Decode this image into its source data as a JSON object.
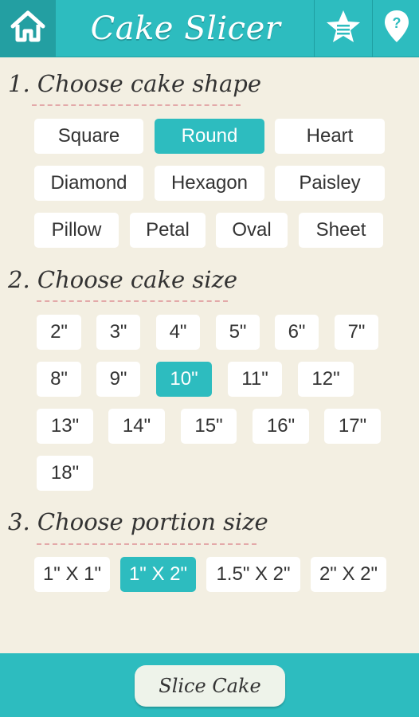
{
  "header": {
    "title": "Cake Slicer",
    "icons": [
      "home-icon",
      "star-list-icon",
      "help-location-icon"
    ]
  },
  "sections": {
    "shape": {
      "title": "1. Choose cake shape"
    },
    "size": {
      "title": "2. Choose cake size"
    },
    "portion": {
      "title": "3. Choose portion size"
    }
  },
  "shapes": [
    "Square",
    "Round",
    "Heart",
    "Diamond",
    "Hexagon",
    "Paisley",
    "Pillow",
    "Petal",
    "Oval",
    "Sheet"
  ],
  "selected_shape": "Round",
  "sizes": [
    "2\"",
    "3\"",
    "4\"",
    "5\"",
    "6\"",
    "7\"",
    "8\"",
    "9\"",
    "10\"",
    "11\"",
    "12\"",
    "13\"",
    "14\"",
    "15\"",
    "16\"",
    "17\"",
    "18\""
  ],
  "selected_size": "10\"",
  "portions": [
    "1\" X 1\"",
    "1\" X 2\"",
    "1.5\" X 2\"",
    "2\" X 2\""
  ],
  "selected_portion": "1\" X 2\"",
  "footer": {
    "slice_label": "Slice Cake"
  },
  "colors": {
    "accent": "#2dbcbf",
    "background": "#f3efe2"
  }
}
